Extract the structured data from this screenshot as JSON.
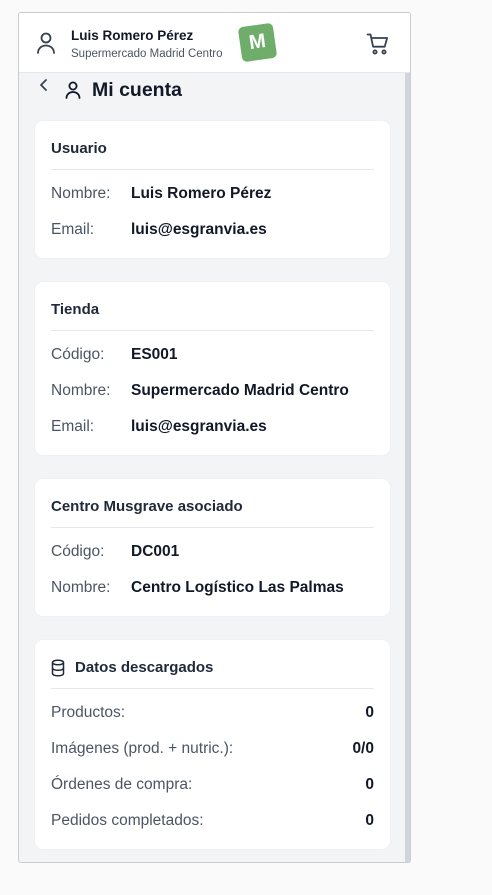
{
  "header": {
    "user_name": "Luis Romero Pérez",
    "store_name": "Supermercado Madrid Centro",
    "logo_letter": "M",
    "logo_color": "#6fae6a"
  },
  "page": {
    "title": "Mi cuenta"
  },
  "usuario": {
    "title": "Usuario",
    "rows": [
      {
        "label": "Nombre:",
        "value": "Luis Romero Pérez"
      },
      {
        "label": "Email:",
        "value": "luis@esgranvia.es"
      }
    ]
  },
  "tienda": {
    "title": "Tienda",
    "rows": [
      {
        "label": "Código:",
        "value": "ES001"
      },
      {
        "label": "Nombre:",
        "value": "Supermercado Madrid Centro"
      },
      {
        "label": "Email:",
        "value": "luis@esgranvia.es"
      }
    ]
  },
  "centro": {
    "title": "Centro Musgrave asociado",
    "rows": [
      {
        "label": "Código:",
        "value": "DC001"
      },
      {
        "label": "Nombre:",
        "value": "Centro Logístico Las Palmas"
      }
    ]
  },
  "datos": {
    "title": "Datos descargados",
    "icon": "database-icon",
    "rows": [
      {
        "label": "Productos:",
        "value": "0"
      },
      {
        "label": "Imágenes (prod. + nutric.):",
        "value": "0/0"
      },
      {
        "label": "Órdenes de compra:",
        "value": "0"
      },
      {
        "label": "Pedidos completados:",
        "value": "0"
      }
    ]
  }
}
